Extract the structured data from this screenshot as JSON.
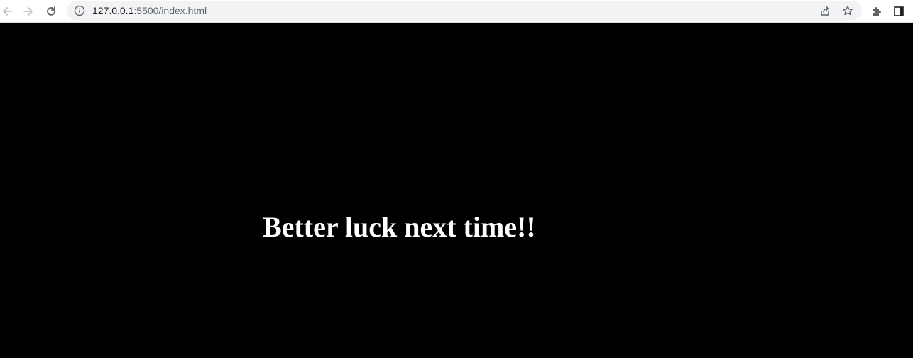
{
  "browser": {
    "url_host": "127.0.0.1",
    "url_rest": ":5500/index.html",
    "icons": {
      "back": "arrow-left-icon",
      "forward": "arrow-right-icon",
      "reload": "reload-icon",
      "info": "info-icon",
      "share": "share-icon",
      "bookmark": "star-icon",
      "extensions": "puzzle-icon",
      "side_panel": "side-panel-icon"
    }
  },
  "page": {
    "message": "Better luck next time!!",
    "background_color": "#000000",
    "text_color": "#ffffff"
  }
}
